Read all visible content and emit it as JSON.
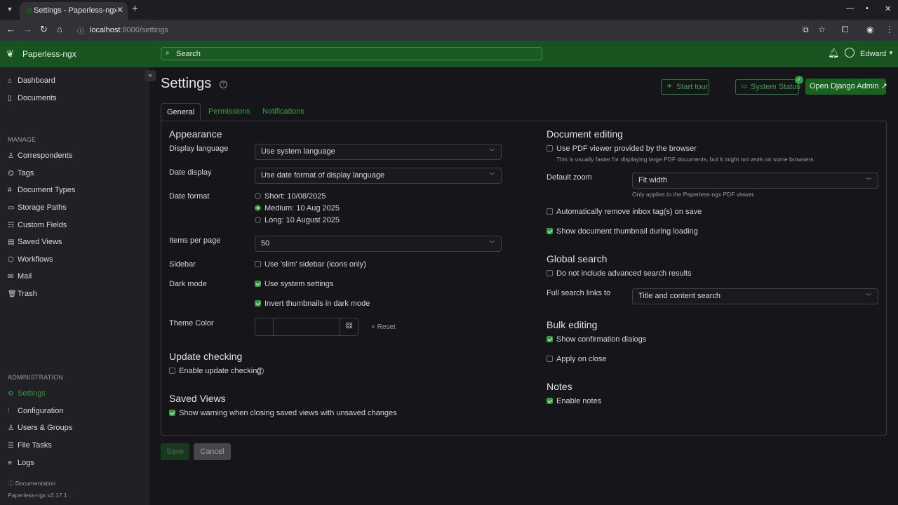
{
  "browser": {
    "tab_title": "Settings - Paperless-ngx",
    "url_host": "localhost",
    "url_path": ":8000/settings"
  },
  "app": {
    "name": "Paperless-ngx",
    "search_placeholder": "Search",
    "user_name": "Edward"
  },
  "sidebar": {
    "top_items": [
      {
        "label": "Dashboard",
        "icon": "house-icon"
      },
      {
        "label": "Documents",
        "icon": "files-icon"
      }
    ],
    "manage_heading": "MANAGE",
    "manage_items": [
      {
        "label": "Correspondents",
        "icon": "person-icon"
      },
      {
        "label": "Tags",
        "icon": "tags-icon"
      },
      {
        "label": "Document Types",
        "icon": "hash-icon"
      },
      {
        "label": "Storage Paths",
        "icon": "folder-icon"
      },
      {
        "label": "Custom Fields",
        "icon": "ui-radios-icon"
      },
      {
        "label": "Saved Views",
        "icon": "collection-icon"
      },
      {
        "label": "Workflows",
        "icon": "boxes-icon"
      },
      {
        "label": "Mail",
        "icon": "envelope-icon"
      },
      {
        "label": "Trash",
        "icon": "trash-icon"
      }
    ],
    "admin_heading": "ADMINISTRATION",
    "admin_items": [
      {
        "label": "Settings",
        "icon": "gear-icon"
      },
      {
        "label": "Configuration",
        "icon": "sliders-icon"
      },
      {
        "label": "Users & Groups",
        "icon": "people-icon"
      },
      {
        "label": "File Tasks",
        "icon": "list-task-icon"
      },
      {
        "label": "Logs",
        "icon": "text-list-icon"
      }
    ],
    "documentation": "Documentation",
    "version": "Paperless-ngx v2.17.1"
  },
  "page": {
    "title": "Settings",
    "start_tour": "Start tour",
    "system_status": "System Status",
    "open_admin": "Open Django Admin",
    "tabs": [
      "General",
      "Permissions",
      "Notifications"
    ]
  },
  "general": {
    "appearance": {
      "heading": "Appearance",
      "display_language_label": "Display language",
      "display_language_value": "Use system language",
      "date_display_label": "Date display",
      "date_display_value": "Use date format of display language",
      "date_format_label": "Date format",
      "date_format_options": [
        "Short: 10/08/2025",
        "Medium: 10 Aug 2025",
        "Long: 10 August 2025"
      ],
      "date_format_selected": 1,
      "items_per_page_label": "Items per page",
      "items_per_page_value": "50",
      "sidebar_label": "Sidebar",
      "sidebar_option": "Use 'slim' sidebar (icons only)",
      "dark_mode_label": "Dark mode",
      "dark_mode_system": "Use system settings",
      "dark_mode_invert": "Invert thumbnails in dark mode",
      "theme_color_label": "Theme Color",
      "reset": "Reset"
    },
    "update_checking": {
      "heading": "Update checking",
      "option": "Enable update checking"
    },
    "saved_views": {
      "heading": "Saved Views",
      "option": "Show warning when closing saved views with unsaved changes"
    },
    "document_editing": {
      "heading": "Document editing",
      "pdf_viewer": "Use PDF viewer provided by the browser",
      "pdf_viewer_hint": "This is usually faster for displaying large PDF documents, but it might not work on some browsers.",
      "default_zoom_label": "Default zoom",
      "default_zoom_value": "Fit width",
      "default_zoom_hint": "Only applies to the Paperless-ngx PDF viewer.",
      "remove_inbox": "Automatically remove inbox tag(s) on save",
      "show_thumbnail": "Show document thumbnail during loading"
    },
    "global_search": {
      "heading": "Global search",
      "no_advanced": "Do not include advanced search results",
      "full_links_label": "Full search links to",
      "full_links_value": "Title and content search"
    },
    "bulk_editing": {
      "heading": "Bulk editing",
      "confirm": "Show confirmation dialogs",
      "apply_close": "Apply on close"
    },
    "notes": {
      "heading": "Notes",
      "enable": "Enable notes"
    }
  },
  "actions": {
    "save": "Save",
    "cancel": "Cancel"
  },
  "colors": {
    "brand": "#17541f",
    "accent": "#2e9b3d"
  }
}
